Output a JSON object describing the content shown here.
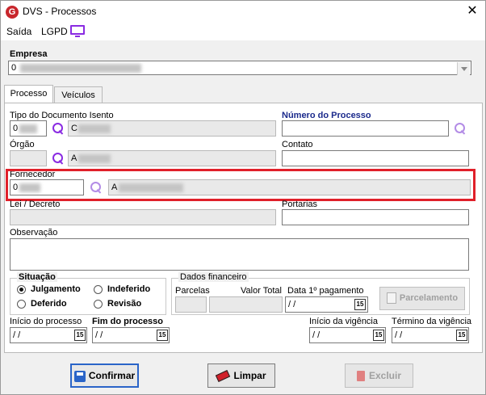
{
  "window": {
    "title": "DVS - Processos",
    "close_glyph": "✕",
    "logo_letter": "G"
  },
  "menu": {
    "items": [
      "Saída",
      "LGPD"
    ]
  },
  "empresa": {
    "label": "Empresa",
    "value_prefix": "0"
  },
  "tabs": [
    {
      "label": "Processo"
    },
    {
      "label": "Veículos"
    }
  ],
  "fields": {
    "tipo_documento": {
      "label": "Tipo do Documento Isento",
      "code": "0",
      "desc": "C"
    },
    "numero_processo": {
      "label": "Número do Processo",
      "value": ""
    },
    "orgao": {
      "label": "Órgão",
      "code": "",
      "desc": "A"
    },
    "contato": {
      "label": "Contato",
      "value": ""
    },
    "fornecedor": {
      "label": "Fornecedor",
      "code": "0",
      "desc": "A"
    },
    "lei_decreto": {
      "label": "Lei / Decreto",
      "value": ""
    },
    "portarias": {
      "label": "Portarias",
      "value": ""
    },
    "observacao": {
      "label": "Observação",
      "value": ""
    }
  },
  "situacao": {
    "title": "Situação",
    "options": [
      "Julgamento",
      "Indeferido",
      "Deferido",
      "Revisão"
    ],
    "selected": "Julgamento"
  },
  "dados_financeiro": {
    "title": "Dados financeiro",
    "parcelas_label": "Parcelas",
    "valor_total_label": "Valor Total",
    "data_pagamento_label": "Data 1º pagamento",
    "data_pagamento_value": " / /",
    "parcelamento_button": "Parcelamento"
  },
  "datas": {
    "inicio_processo_label": "Início do processo",
    "fim_processo_label": "Fim do processo",
    "inicio_vigencia_label": "Início da vigência",
    "termino_vigencia_label": "Término da vigência",
    "empty_date": " / /",
    "calendar_glyph": "15"
  },
  "buttons": {
    "confirmar": "Confirmar",
    "limpar": "Limpar",
    "excluir": "Excluir"
  },
  "colors": {
    "accent_purple": "#8a2be2",
    "highlight_red": "#e0202a",
    "title_blue": "#1b2a8c"
  }
}
